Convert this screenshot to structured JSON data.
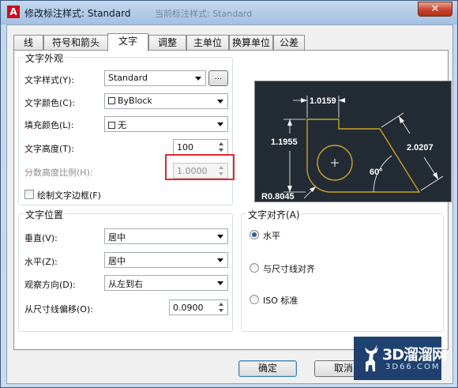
{
  "window": {
    "title": "修改标注样式: Standard",
    "background_title": "当前标注样式: Standard",
    "close_glyph": "✕",
    "app_icon": "A"
  },
  "tabs": [
    {
      "label": "线",
      "active": false
    },
    {
      "label": "符号和箭头",
      "active": false
    },
    {
      "label": "文字",
      "active": true
    },
    {
      "label": "调整",
      "active": false
    },
    {
      "label": "主单位",
      "active": false
    },
    {
      "label": "换算单位",
      "active": false
    },
    {
      "label": "公差",
      "active": false
    }
  ],
  "appearance": {
    "title": "文字外观",
    "style_label": "文字样式(Y):",
    "style_value": "Standard",
    "browse_label": "...",
    "color_label": "文字颜色(C):",
    "color_value": "ByBlock",
    "fill_label": "填充颜色(L):",
    "fill_value": "无",
    "height_label": "文字高度(T):",
    "height_value": "100",
    "fraction_label": "分数高度比例(H):",
    "fraction_value": "1.0000",
    "frame_label": "绘制文字边框(F)"
  },
  "placement": {
    "title": "文字位置",
    "vertical_label": "垂直(V):",
    "vertical_value": "居中",
    "horizontal_label": "水平(Z):",
    "horizontal_value": "居中",
    "direction_label": "观察方向(D):",
    "direction_value": "从左到右",
    "offset_label": "从尺寸线偏移(O):",
    "offset_value": "0.0900"
  },
  "alignment": {
    "title": "文字对齐(A)",
    "options": [
      {
        "label": "水平",
        "checked": true
      },
      {
        "label": "与尺寸线对齐",
        "checked": false
      },
      {
        "label": "ISO 标准",
        "checked": false
      }
    ]
  },
  "preview": {
    "dim_top": "1.0159",
    "dim_left": "1.1955",
    "dim_right": "2.0207",
    "dim_angle": "60°",
    "dim_radius": "R0.8045",
    "colors": {
      "background": "#232b35",
      "geometry": "#c9a227",
      "dimension": "#ffffff"
    }
  },
  "buttons": {
    "ok": "确定",
    "cancel": "取消"
  },
  "watermark": {
    "title": "3D溜溜网",
    "subtitle": "3D66.COM"
  },
  "colors": {
    "highlight": "#e2262e"
  }
}
